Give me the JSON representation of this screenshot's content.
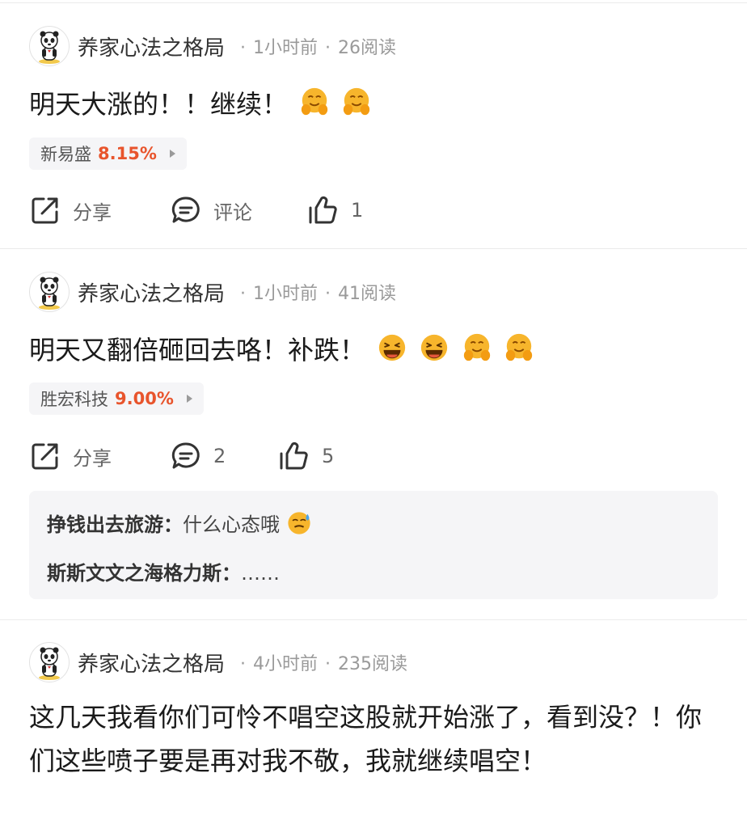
{
  "posts": [
    {
      "author": "养家心法之格局",
      "time": "1小时前",
      "reads": "26阅读",
      "text": "明天大涨的！！继续！",
      "emojis": [
        "hug-emoji",
        "hug-emoji"
      ],
      "stock": {
        "name": "新易盛",
        "change": "8.15%"
      },
      "actions": {
        "share": "分享",
        "comment": "评论",
        "like": "1"
      }
    },
    {
      "author": "养家心法之格局",
      "time": "1小时前",
      "reads": "41阅读",
      "text": "明天又翻倍砸回去咯！补跌！",
      "emojis": [
        "laugh-emoji",
        "laugh-emoji",
        "hug-emoji",
        "hug-emoji"
      ],
      "stock": {
        "name": "胜宏科技",
        "change": "9.00%"
      },
      "actions": {
        "share": "分享",
        "comment": "2",
        "like": "5"
      },
      "comments": [
        {
          "user": "挣钱出去旅游",
          "sep": "：",
          "text": "什么心态哦",
          "emoji": "sweat-emoji"
        },
        {
          "user": "斯斯文文之海格力斯",
          "sep": "：",
          "text": "……"
        }
      ]
    },
    {
      "author": "养家心法之格局",
      "time": "4小时前",
      "reads": "235阅读",
      "text": "这几天我看你们可怜不唱空这股就开始涨了，看到没？！你们这些喷子要是再对我不敬，我就继续唱空！"
    }
  ],
  "colors": {
    "accent_red": "#e8542c",
    "meta_gray": "#9a9a9a",
    "tag_bg": "#f5f5f7"
  }
}
